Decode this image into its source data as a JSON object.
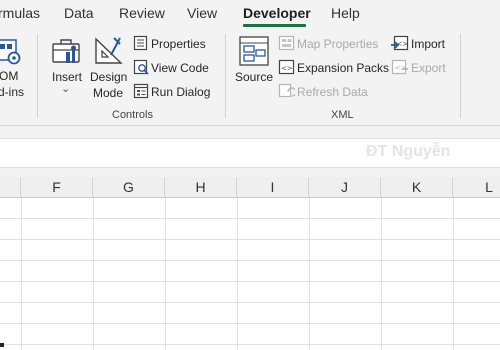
{
  "tabs": [
    {
      "label": "rmulas",
      "active": false
    },
    {
      "label": "Data",
      "active": false
    },
    {
      "label": "Review",
      "active": false
    },
    {
      "label": "View",
      "active": false
    },
    {
      "label": "Developer",
      "active": true
    },
    {
      "label": "Help",
      "active": false
    }
  ],
  "ribbon": {
    "addins": {
      "line1": "OM",
      "line2": "d-ins"
    },
    "controls": {
      "insert_label": "Insert",
      "insert_arrow": "⌄",
      "design_mode_line1": "Design",
      "design_mode_line2": "Mode",
      "properties_label": "Properties",
      "view_code_label": "View Code",
      "run_dialog_label": "Run Dialog",
      "group_label": "Controls"
    },
    "xml": {
      "source_label": "Source",
      "map_properties_label": "Map Properties",
      "expansion_packs_label": "Expansion Packs",
      "refresh_data_label": "Refresh Data",
      "import_label": "Import",
      "export_label": "Export",
      "group_label": "XML"
    }
  },
  "watermark": "ĐT Nguyễn",
  "columns": [
    "F",
    "G",
    "H",
    "I",
    "J",
    "K",
    "L"
  ],
  "colors": {
    "accent": "#1e7145",
    "icon_blue": "#2b579a",
    "disabled": "#a8a8a8"
  }
}
